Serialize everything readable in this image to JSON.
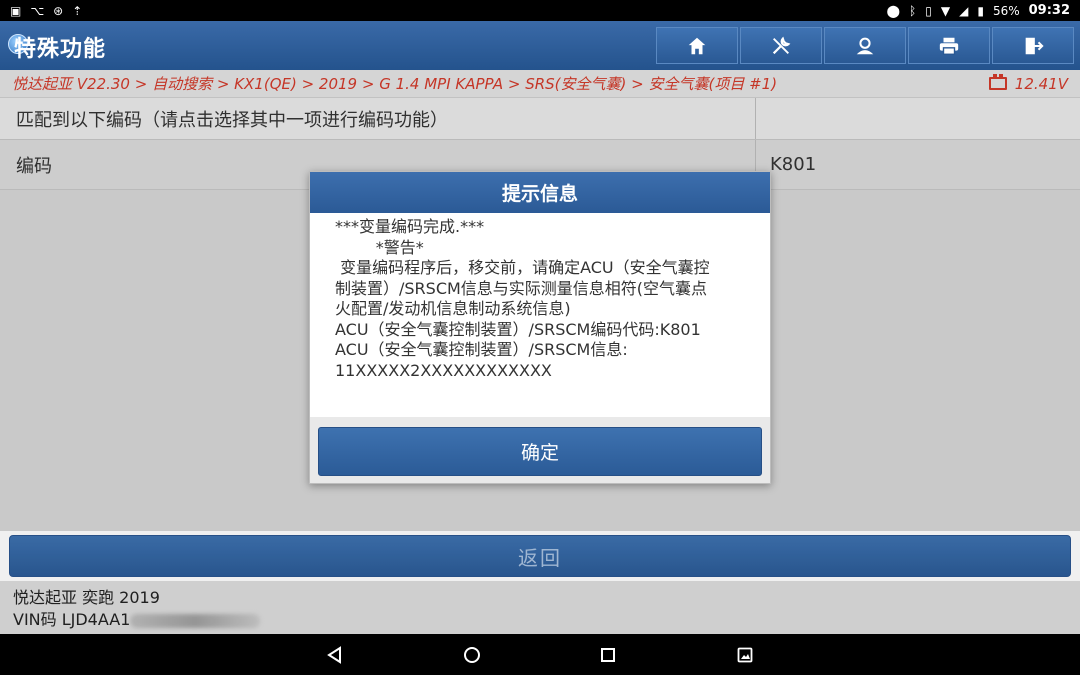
{
  "status_bar": {
    "battery_percent": "56%",
    "time": "09:32",
    "left_icons": [
      "image-icon",
      "vpn-icon",
      "usb-icon",
      "upload-icon"
    ],
    "right_icons": [
      "location-icon",
      "bluetooth-icon",
      "vibrate-icon",
      "wifi-icon",
      "signal-icon",
      "battery-icon"
    ]
  },
  "header": {
    "title": "特殊功能",
    "toolbar_icons": [
      "home-icon",
      "diagnostic-tools-icon",
      "user-icon",
      "print-icon",
      "exit-icon"
    ]
  },
  "breadcrumb": {
    "path": "悦达起亚 V22.30 > 自动搜索 > KX1(QE) > 2019 > G 1.4 MPI KAPPA > SRS(安全气囊) > 安全气囊(项目 #1)",
    "voltage": "12.41V"
  },
  "table": {
    "header_text": "匹配到以下编码（请点击选择其中一项进行编码功能）",
    "rows": [
      {
        "label": "编码",
        "value": "K801"
      }
    ]
  },
  "dialog": {
    "title": "提示信息",
    "lines": [
      "***变量编码完成.***",
      "        *警告*",
      " 变量编码程序后，移交前，请确定ACU（安全气囊控",
      "制装置）/SRSCM信息与实际测量信息相符(空气囊点",
      "火配置/发动机信息制动系统信息)",
      "ACU（安全气囊控制装置）/SRSCM编码代码:K801",
      "ACU（安全气囊控制装置）/SRSCM信息:",
      "11XXXXX2XXXXXXXXXXXX"
    ],
    "ok_label": "确定"
  },
  "return_label": "返回",
  "vehicle": {
    "model": "悦达起亚 奕跑 2019",
    "vin_label": "VIN码 LJD4AA1"
  },
  "colors": {
    "header_blue": "#2b5a96",
    "breadcrumb_red": "#d23a2a"
  }
}
